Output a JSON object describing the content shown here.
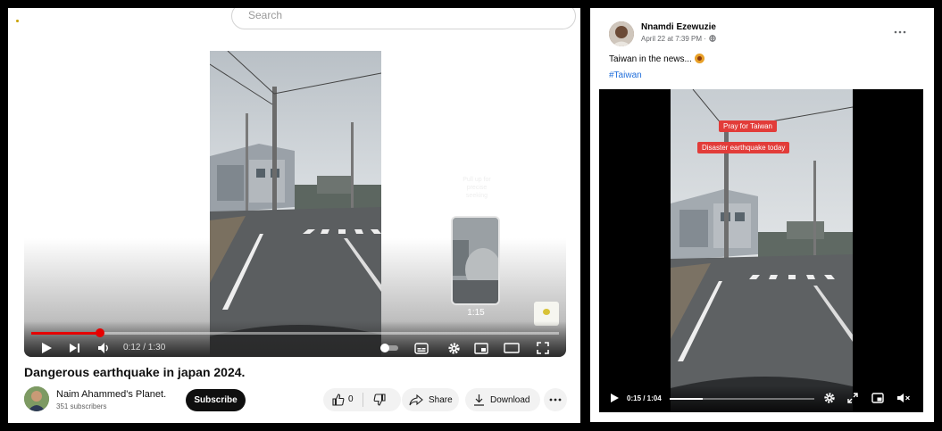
{
  "youtube": {
    "search": {
      "placeholder": "Search"
    },
    "player": {
      "current_time": "0:12",
      "duration": "1:30",
      "time_display": "0:12 / 1:30",
      "progress": 0.13,
      "preview_hint": "Pull up for precise seeking",
      "preview_time": "1:15"
    },
    "video_title": "Dangerous earthquake in japan 2024.",
    "channel": {
      "name": "Naim Ahammed's Planet.",
      "subscribers": "351 subscribers",
      "subscribe_label": "Subscribe"
    },
    "actions": {
      "like_count": "0",
      "share_label": "Share",
      "download_label": "Download"
    },
    "colors": {
      "progress": "#e60000",
      "subscribe_bg": "#0f0f0f"
    }
  },
  "facebook": {
    "author": "Nnamdi Ezewuzie",
    "date": "April 22 at 7:39 PM ·",
    "caption": "Taiwan in the news...",
    "hashtag": "#Taiwan",
    "sticker_1": "Pray for Taiwan",
    "sticker_2": "Disaster earthquake today",
    "time_display": "0:15 / 1:04",
    "progress": 0.23,
    "colors": {
      "sticker": "#e23c39",
      "link": "#216fdb"
    }
  }
}
